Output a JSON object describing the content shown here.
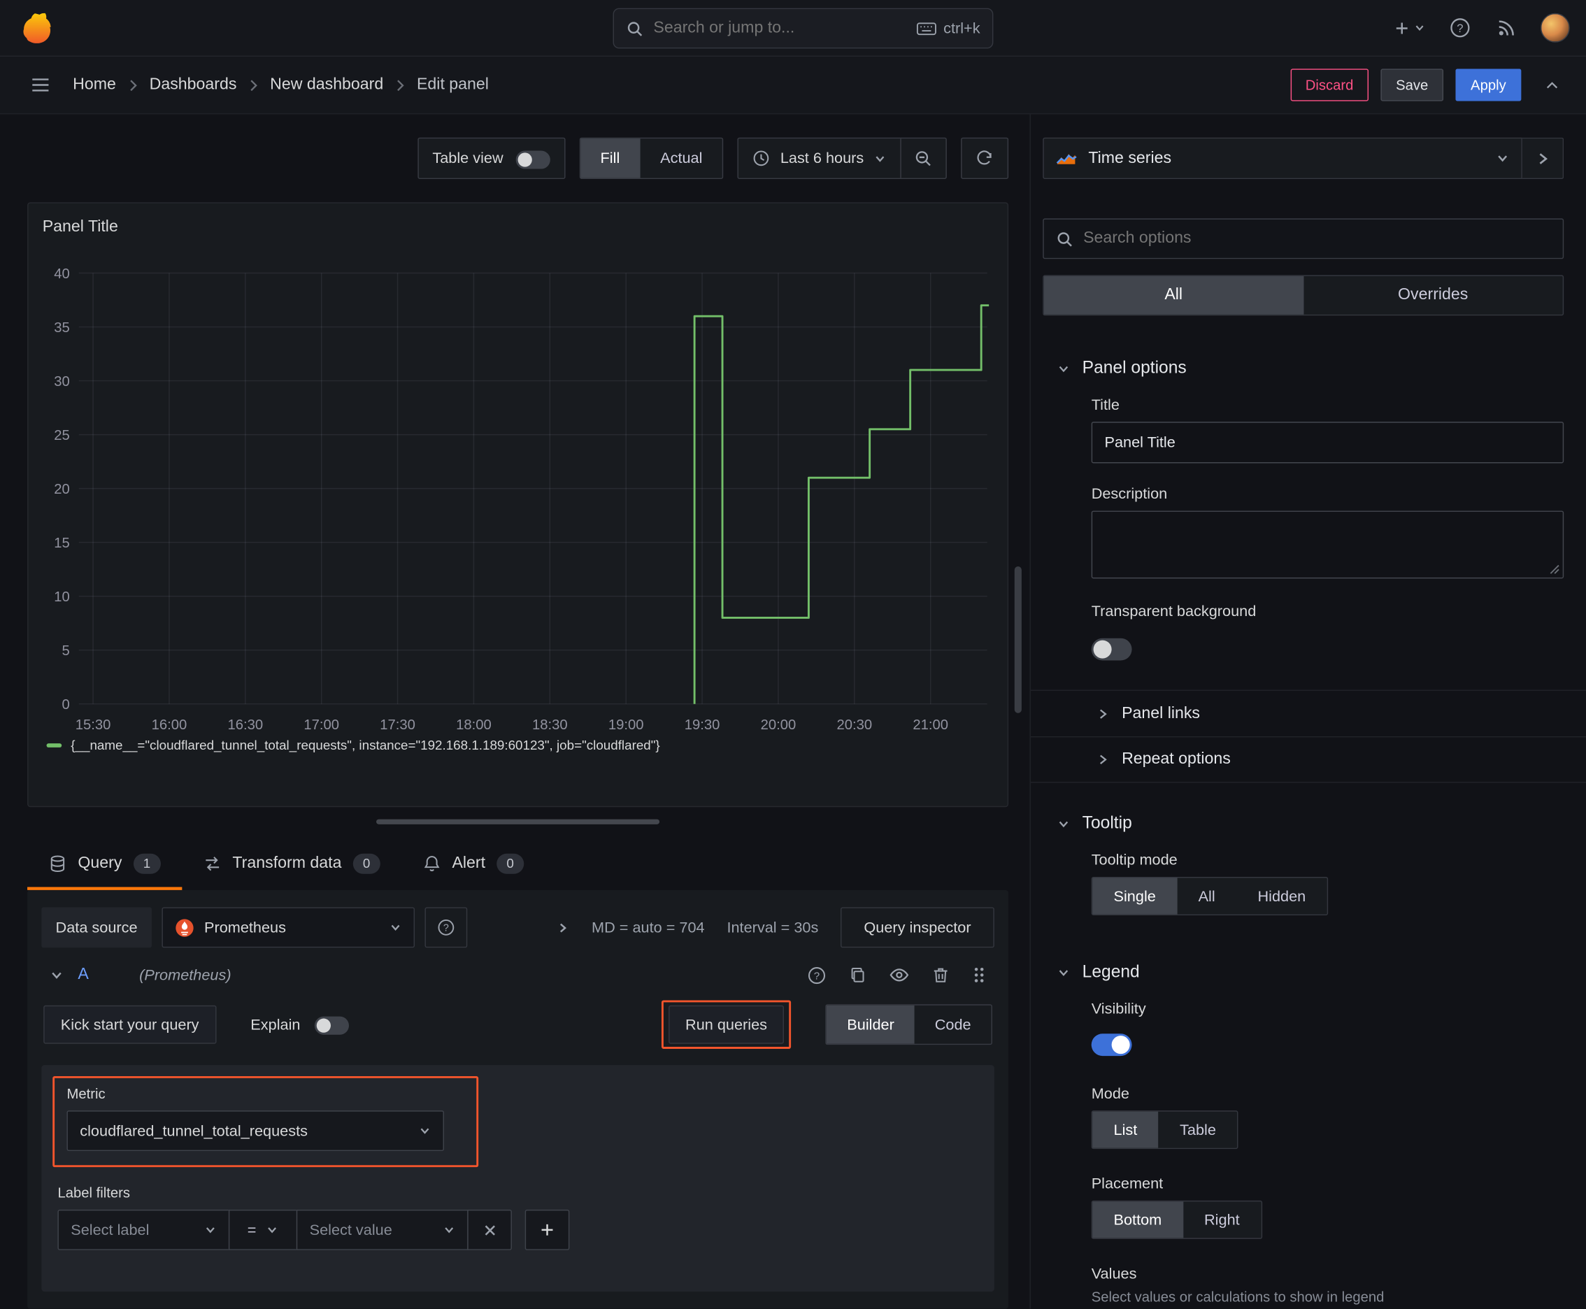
{
  "colors": {
    "accent_blue": "#3d71d9",
    "accent_orange": "#ff780a",
    "annotation": "#f2552c",
    "series_green": "#73bf69",
    "danger_pink": "#ff5286",
    "query_ref_blue": "#6e9fff",
    "prometheus_orange": "#e6522c"
  },
  "topbar": {
    "search_placeholder": "Search or jump to...",
    "search_shortcut": "ctrl+k"
  },
  "breadcrumb": {
    "items": [
      "Home",
      "Dashboards",
      "New dashboard",
      "Edit panel"
    ],
    "discard": "Discard",
    "save": "Save",
    "apply": "Apply"
  },
  "toolbar": {
    "table_view": "Table view",
    "fill": "Fill",
    "actual": "Actual",
    "time_range": "Last 6 hours"
  },
  "panel": {
    "title": "Panel Title"
  },
  "chart_data": {
    "type": "line",
    "title": "Panel Title",
    "x_ticks": [
      "15:30",
      "16:00",
      "16:30",
      "17:00",
      "17:30",
      "18:00",
      "18:30",
      "19:00",
      "19:30",
      "20:00",
      "20:30",
      "21:00"
    ],
    "y_ticks": [
      0,
      5,
      10,
      15,
      20,
      25,
      30,
      35,
      40
    ],
    "ylim": [
      0,
      40
    ],
    "x_start": "15:30",
    "x_end": "21:26",
    "grid": true,
    "legend_position": "bottom",
    "line_color": "#73bf69",
    "series": [
      {
        "name": "{__name__=\"cloudflared_tunnel_total_requests\", instance=\"192.168.1.189:60123\", job=\"cloudflared\"}",
        "step": true,
        "points": [
          [
            "19:27",
            0
          ],
          [
            "19:27",
            36
          ],
          [
            "19:38",
            36
          ],
          [
            "19:38",
            8
          ],
          [
            "20:12",
            8
          ],
          [
            "20:12",
            21
          ],
          [
            "20:36",
            21
          ],
          [
            "20:36",
            25.5
          ],
          [
            "20:52",
            25.5
          ],
          [
            "20:52",
            31
          ],
          [
            "21:20",
            31
          ],
          [
            "21:20",
            37
          ],
          [
            "21:23",
            37
          ]
        ]
      }
    ]
  },
  "tabs": {
    "query": {
      "label": "Query",
      "badge": "1"
    },
    "transform": {
      "label": "Transform data",
      "badge": "0"
    },
    "alert": {
      "label": "Alert",
      "badge": "0"
    }
  },
  "query": {
    "datasource_label": "Data source",
    "datasource_value": "Prometheus",
    "stat_md": "MD = auto = 704",
    "stat_interval": "Interval = 30s",
    "inspector": "Query inspector",
    "ref_id": "A",
    "ref_note": "(Prometheus)",
    "kickstart": "Kick start your query",
    "explain": "Explain",
    "run_queries": "Run queries",
    "builder": "Builder",
    "code": "Code",
    "metric_label": "Metric",
    "metric_value": "cloudflared_tunnel_total_requests",
    "label_filters": "Label filters",
    "select_label_placeholder": "Select label",
    "operator": "=",
    "select_value_placeholder": "Select value"
  },
  "options": {
    "visualization": "Time series",
    "search_placeholder": "Search options",
    "tab_all": "All",
    "tab_overrides": "Overrides",
    "panel_options_heading": "Panel options",
    "title_label": "Title",
    "title_value": "Panel Title",
    "description_label": "Description",
    "transparent_label": "Transparent background",
    "panel_links": "Panel links",
    "repeat_options": "Repeat options",
    "tooltip_heading": "Tooltip",
    "tooltip_mode_label": "Tooltip mode",
    "tooltip_modes": [
      "Single",
      "All",
      "Hidden"
    ],
    "tooltip_selected": "Single",
    "legend_heading": "Legend",
    "visibility_label": "Visibility",
    "mode_label": "Mode",
    "legend_modes": [
      "List",
      "Table"
    ],
    "legend_mode_selected": "List",
    "placement_label": "Placement",
    "placements": [
      "Bottom",
      "Right"
    ],
    "placement_selected": "Bottom",
    "values_label": "Values",
    "values_help": "Select values or calculations to show in legend"
  }
}
